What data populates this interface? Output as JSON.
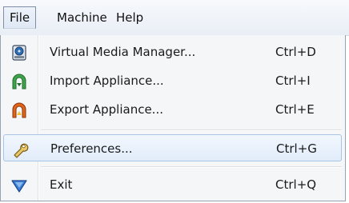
{
  "menubar": {
    "items": [
      {
        "label": "File",
        "active": true
      },
      {
        "label": "Machine"
      },
      {
        "label": "Help"
      }
    ]
  },
  "menu": {
    "items": [
      {
        "label": "Virtual Media Manager...",
        "shortcut": "Ctrl+D",
        "icon": "virtual-media-manager-icon"
      },
      {
        "label": "Import Appliance...",
        "shortcut": "Ctrl+I",
        "icon": "import-appliance-icon"
      },
      {
        "label": "Export Appliance...",
        "shortcut": "Ctrl+E",
        "icon": "export-appliance-icon"
      },
      {
        "label": "Preferences...",
        "shortcut": "Ctrl+G",
        "icon": "wrench-icon",
        "highlighted": true
      },
      {
        "label": "Exit",
        "shortcut": "Ctrl+Q",
        "icon": "exit-icon"
      }
    ]
  },
  "colors": {
    "highlight_border": "#a8c4e6",
    "menu_background": "#f5f6f7"
  }
}
